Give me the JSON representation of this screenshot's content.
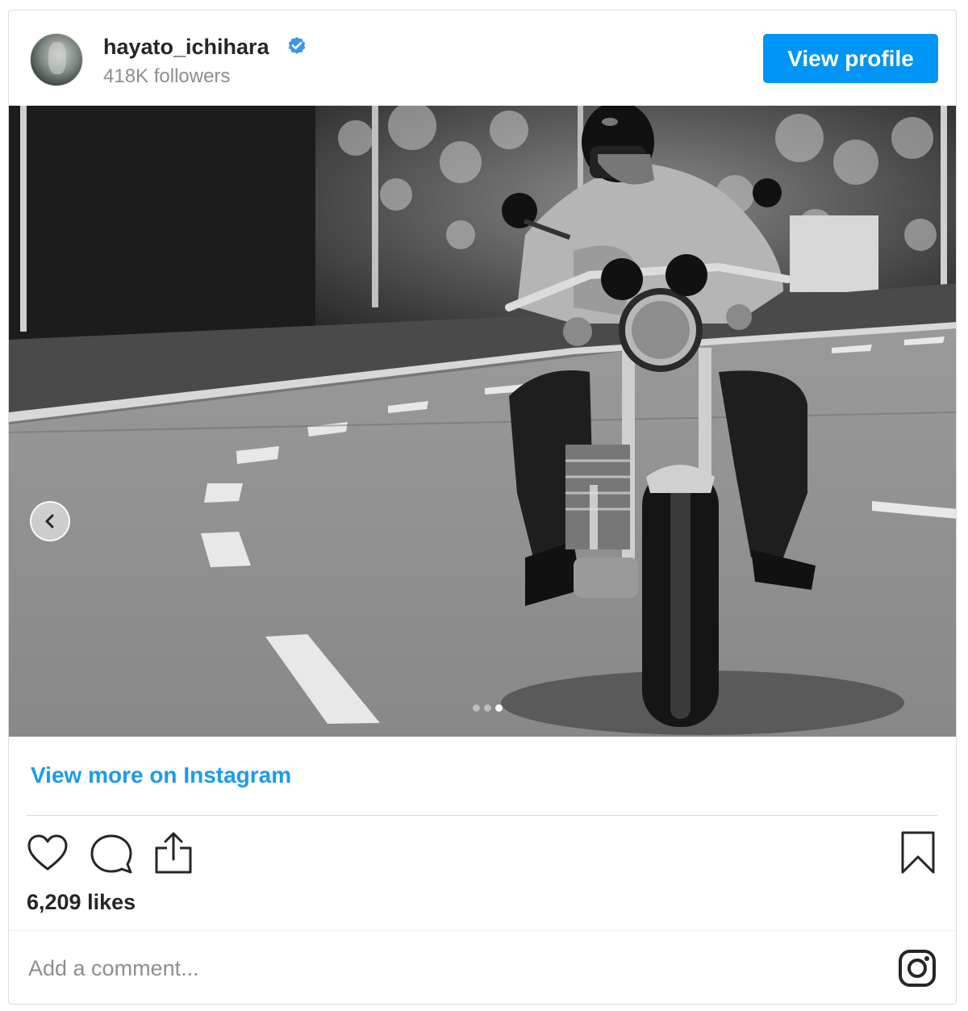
{
  "header": {
    "username": "hayato_ichihara",
    "verified": true,
    "followers": "418K followers",
    "view_profile_label": "View profile"
  },
  "post": {
    "photo_description": "black-and-white photo of a helmeted rider on a motorcycle on a curving road",
    "carousel_dots": 3,
    "active_dot": 3
  },
  "links": {
    "view_more": "View more on Instagram"
  },
  "actions": {
    "icons": [
      "heart-icon",
      "comment-icon",
      "share-icon",
      "bookmark-icon"
    ]
  },
  "likes": "6,209 likes",
  "comment": {
    "placeholder": "Add a comment..."
  },
  "colors": {
    "accent": "#0095f6",
    "link": "#1a9bf0",
    "text": "#262626",
    "muted": "#8e8e8e",
    "border": "#dbdbdb"
  }
}
